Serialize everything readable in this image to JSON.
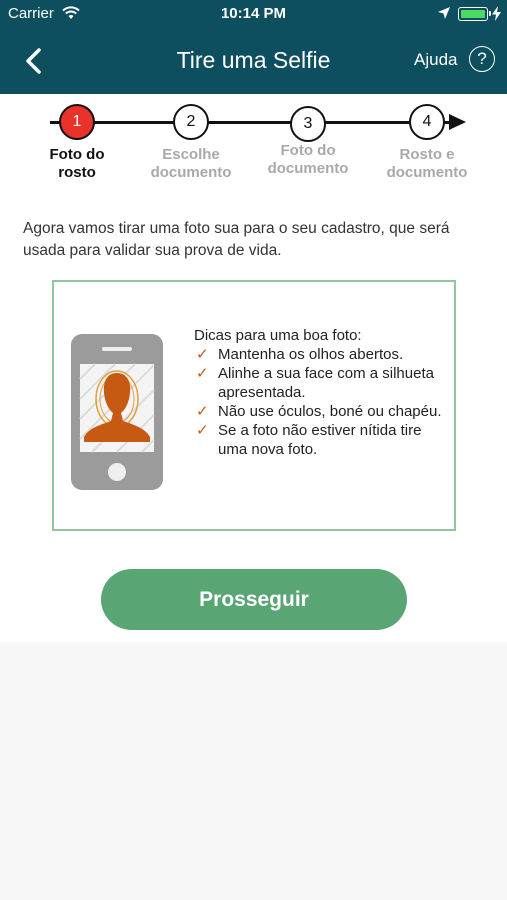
{
  "status_bar": {
    "carrier": "Carrier",
    "time": "10:14 PM"
  },
  "nav": {
    "title": "Tire uma Selfie",
    "help_label": "Ajuda",
    "help_icon": "?"
  },
  "steps": [
    {
      "number": "1",
      "label_line1": "Foto do",
      "label_line2": "rosto",
      "active": true
    },
    {
      "number": "2",
      "label_line1": "Escolhe",
      "label_line2": "documento",
      "active": false
    },
    {
      "number": "3",
      "label_line1": "Foto do",
      "label_line2": "documento",
      "active": false
    },
    {
      "number": "4",
      "label_line1": "Rosto e",
      "label_line2": "documento",
      "active": false
    }
  ],
  "intro_text": "Agora vamos tirar uma foto sua para o seu cadastro, que será usada para validar sua prova de vida.",
  "tips": {
    "title": "Dicas para uma boa foto:",
    "items": [
      "Mantenha os olhos abertos.",
      "Alinhe a sua face com a silhueta apresentada.",
      "Não use óculos, boné ou chapéu.",
      "Se a foto não estiver nítida tire uma nova foto."
    ]
  },
  "proceed_button": "Prosseguir",
  "colors": {
    "header": "#0d4f5f",
    "active_step": "#e8322a",
    "button": "#5aa574",
    "tip_border": "#8fc7a0",
    "checkmark": "#c65a12",
    "silhouette": "#c65a12"
  },
  "icons": [
    "wifi-icon",
    "location-arrow-icon",
    "battery-icon",
    "charging-bolt-icon",
    "back-chevron-icon",
    "help-circle-icon",
    "phone-selfie-illustration",
    "checkmark-icon"
  ]
}
